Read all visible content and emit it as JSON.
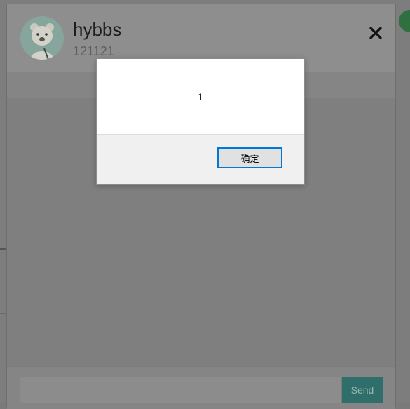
{
  "chat": {
    "contact_name": "hybbs",
    "contact_id": "121121",
    "close_symbol": "✖",
    "input_value": "",
    "send_label": "Send"
  },
  "alert": {
    "message": "1",
    "ok_label": "确定"
  },
  "colors": {
    "send_button": "#2f6e6a",
    "dialog_focus_border": "#0078d7"
  }
}
